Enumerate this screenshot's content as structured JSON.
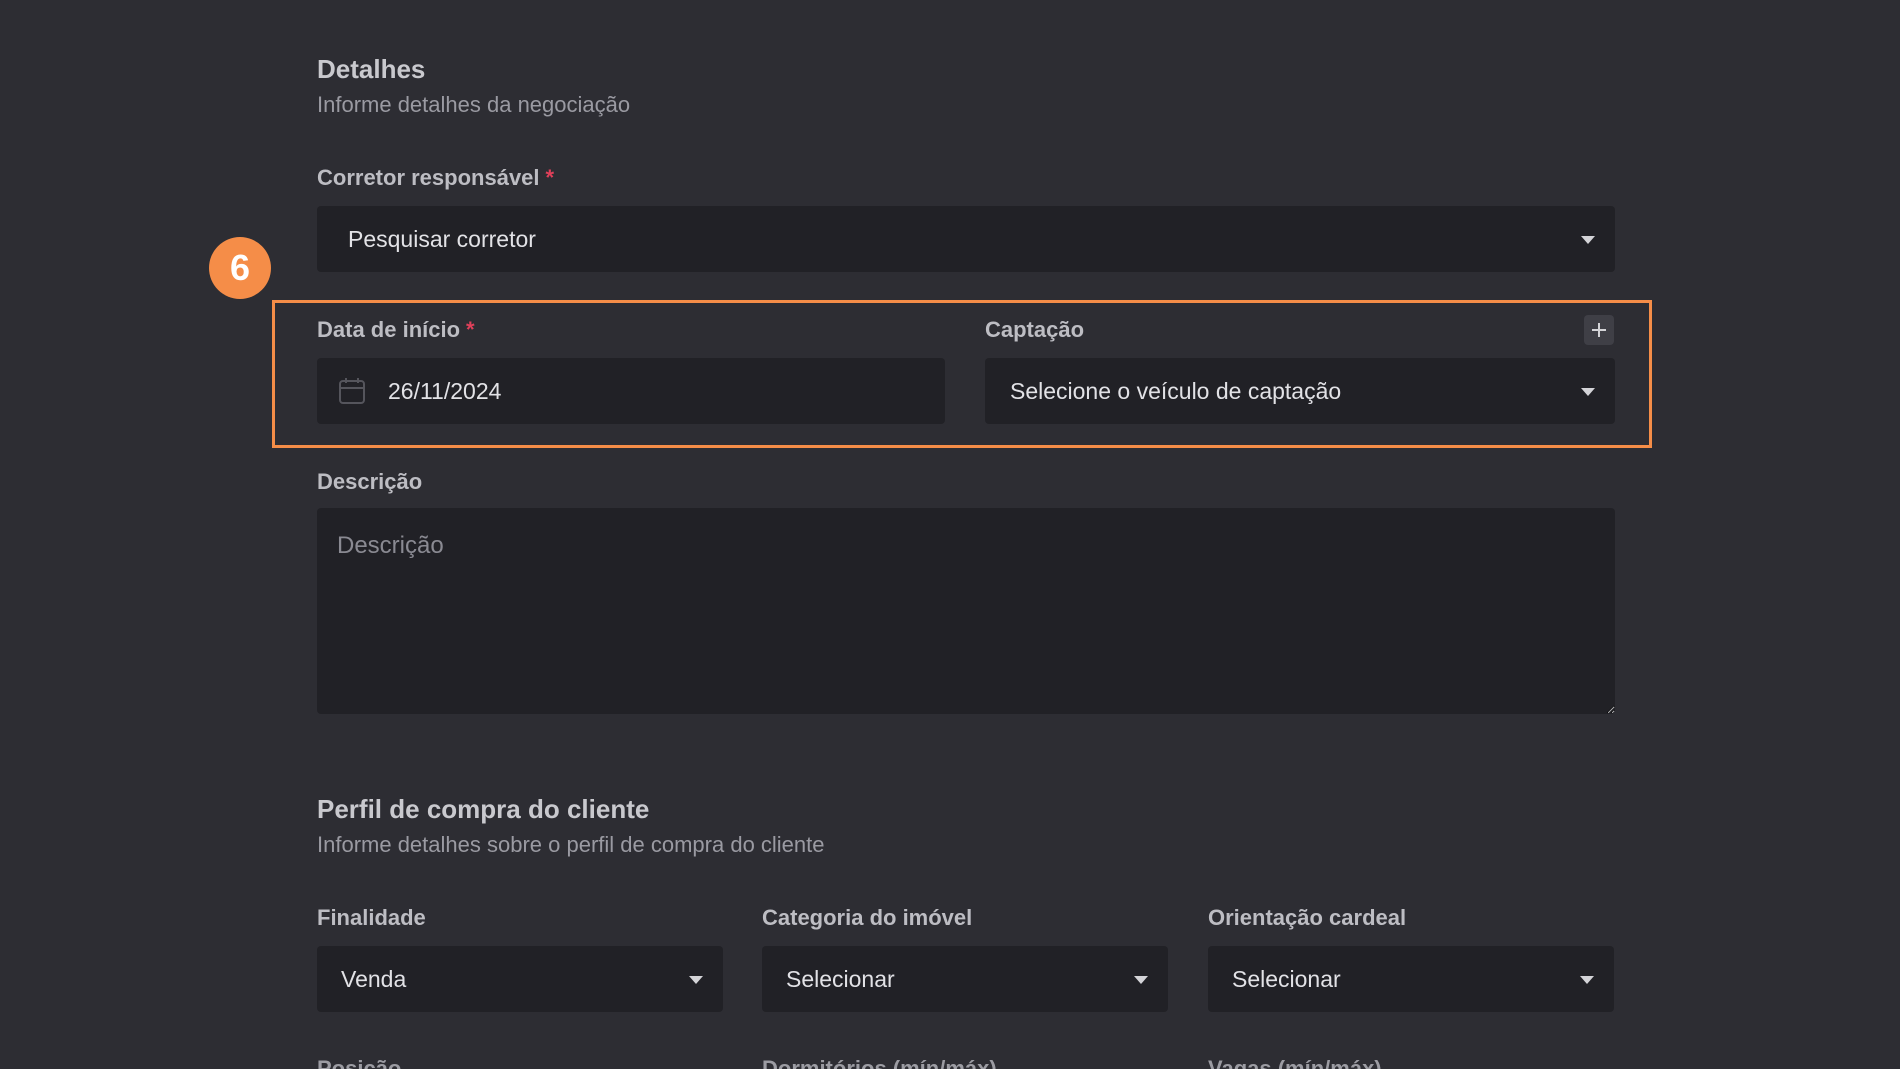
{
  "details": {
    "title": "Detalhes",
    "subtitle": "Informe detalhes da negociação",
    "broker": {
      "label": "Corretor responsável",
      "required_mark": "*",
      "value": "Pesquisar corretor"
    },
    "start_date": {
      "label": "Data de início",
      "required_mark": "*",
      "value": "26/11/2024"
    },
    "capture": {
      "label": "Captação",
      "value": "Selecione o veículo de captação",
      "add_label": "+"
    },
    "description": {
      "label": "Descrição",
      "placeholder": "Descrição"
    }
  },
  "step_badge": "6",
  "profile": {
    "title": "Perfil de compra do cliente",
    "subtitle": "Informe detalhes sobre o perfil de compra do cliente",
    "purpose": {
      "label": "Finalidade",
      "value": "Venda"
    },
    "category": {
      "label": "Categoria do imóvel",
      "value": "Selecionar"
    },
    "orientation": {
      "label": "Orientação cardeal",
      "value": "Selecionar"
    },
    "position_label": "Posição",
    "bedrooms_label": "Dormitórios (mín/máx)",
    "parking_label": "Vagas (mín/máx)"
  },
  "colors": {
    "background": "#2d2d33",
    "field": "#212126",
    "accent": "#f58d48",
    "required": "#e0405a"
  }
}
